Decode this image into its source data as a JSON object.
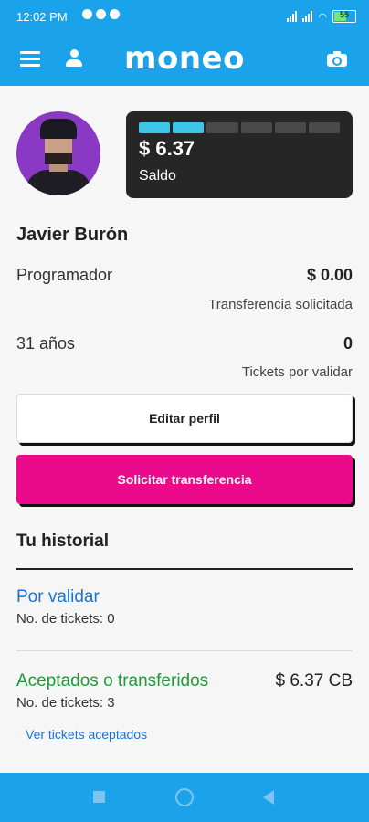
{
  "status_bar": {
    "time": "12:02 PM",
    "battery": "55"
  },
  "app_bar": {
    "logo": "moneo",
    "icons": [
      "menu-icon",
      "person-icon",
      "camera-icon"
    ]
  },
  "balance_card": {
    "amount": "$ 6.37",
    "label": "Saldo",
    "progress_segments_total": 6,
    "progress_segments_filled": 2
  },
  "profile": {
    "name": "Javier Burón",
    "occupation": "Programador",
    "age": "31 años",
    "transfer_requested_amount": "$ 0.00",
    "transfer_requested_label": "Transferencia solicitada",
    "tickets_pending_count": "0",
    "tickets_pending_label": "Tickets por validar"
  },
  "buttons": {
    "edit_profile": "Editar perfil",
    "request_transfer": "Solicitar transferencia"
  },
  "history": {
    "title": "Tu historial",
    "pending": {
      "title": "Por validar",
      "tickets": "No. de tickets: 0"
    },
    "accepted": {
      "title": "Aceptados o transferidos",
      "tickets": "No. de tickets: 3",
      "amount": "$ 6.37 CB",
      "link": "Ver tickets aceptados"
    }
  },
  "colors": {
    "primary": "#1aa3ea",
    "accent": "#ec0a8c",
    "pending": "#1a73d8",
    "accepted": "#1f9b3a",
    "card": "#262626"
  }
}
